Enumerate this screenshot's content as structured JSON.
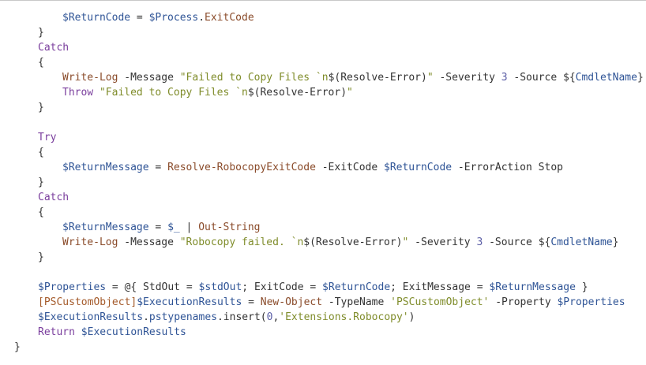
{
  "colors": {
    "background": "#ffffff",
    "default": "#333333",
    "keyword": "#7a3e9d",
    "variable": "#2f5496",
    "command": "#8a4b2a",
    "string": "#7f8c2a",
    "number": "#5b5ea6",
    "type": "#a45a2a"
  },
  "code_lines": [
    {
      "indent": 2,
      "tokens": [
        {
          "t": "variable",
          "v": "$ReturnCode"
        },
        {
          "t": "default",
          "v": " = "
        },
        {
          "t": "variable",
          "v": "$Process"
        },
        {
          "t": "default",
          "v": "."
        },
        {
          "t": "command",
          "v": "ExitCode"
        }
      ]
    },
    {
      "indent": 1,
      "tokens": [
        {
          "t": "default",
          "v": "}"
        }
      ]
    },
    {
      "indent": 1,
      "tokens": [
        {
          "t": "keyword",
          "v": "Catch"
        }
      ]
    },
    {
      "indent": 1,
      "tokens": [
        {
          "t": "default",
          "v": "{"
        }
      ]
    },
    {
      "indent": 2,
      "tokens": [
        {
          "t": "command",
          "v": "Write-Log"
        },
        {
          "t": "default",
          "v": " -Message "
        },
        {
          "t": "string",
          "v": "\"Failed to Copy Files `n"
        },
        {
          "t": "default",
          "v": "$(Resolve-Error)"
        },
        {
          "t": "string",
          "v": "\""
        },
        {
          "t": "default",
          "v": " -Severity "
        },
        {
          "t": "number",
          "v": "3"
        },
        {
          "t": "default",
          "v": " -Source ${"
        },
        {
          "t": "variable",
          "v": "CmdletName"
        },
        {
          "t": "default",
          "v": "}"
        }
      ]
    },
    {
      "indent": 2,
      "tokens": [
        {
          "t": "keyword",
          "v": "Throw"
        },
        {
          "t": "default",
          "v": " "
        },
        {
          "t": "string",
          "v": "\"Failed to Copy Files `n"
        },
        {
          "t": "default",
          "v": "$(Resolve-Error)"
        },
        {
          "t": "string",
          "v": "\""
        }
      ]
    },
    {
      "indent": 1,
      "tokens": [
        {
          "t": "default",
          "v": "}"
        }
      ]
    },
    {
      "indent": 1,
      "tokens": []
    },
    {
      "indent": 1,
      "tokens": [
        {
          "t": "keyword",
          "v": "Try"
        }
      ]
    },
    {
      "indent": 1,
      "tokens": [
        {
          "t": "default",
          "v": "{"
        }
      ]
    },
    {
      "indent": 2,
      "tokens": [
        {
          "t": "variable",
          "v": "$ReturnMessage"
        },
        {
          "t": "default",
          "v": " = "
        },
        {
          "t": "command",
          "v": "Resolve-RobocopyExitCode"
        },
        {
          "t": "default",
          "v": " -ExitCode "
        },
        {
          "t": "variable",
          "v": "$ReturnCode"
        },
        {
          "t": "default",
          "v": " -ErrorAction Stop"
        }
      ]
    },
    {
      "indent": 1,
      "tokens": [
        {
          "t": "default",
          "v": "}"
        }
      ]
    },
    {
      "indent": 1,
      "tokens": [
        {
          "t": "keyword",
          "v": "Catch"
        }
      ]
    },
    {
      "indent": 1,
      "tokens": [
        {
          "t": "default",
          "v": "{"
        }
      ]
    },
    {
      "indent": 2,
      "tokens": [
        {
          "t": "variable",
          "v": "$ReturnMessage"
        },
        {
          "t": "default",
          "v": " = "
        },
        {
          "t": "variable",
          "v": "$_"
        },
        {
          "t": "default",
          "v": " | "
        },
        {
          "t": "command",
          "v": "Out-String"
        }
      ]
    },
    {
      "indent": 2,
      "tokens": [
        {
          "t": "command",
          "v": "Write-Log"
        },
        {
          "t": "default",
          "v": " -Message "
        },
        {
          "t": "string",
          "v": "\"Robocopy failed. `n"
        },
        {
          "t": "default",
          "v": "$(Resolve-Error)"
        },
        {
          "t": "string",
          "v": "\""
        },
        {
          "t": "default",
          "v": " -Severity "
        },
        {
          "t": "number",
          "v": "3"
        },
        {
          "t": "default",
          "v": " -Source ${"
        },
        {
          "t": "variable",
          "v": "CmdletName"
        },
        {
          "t": "default",
          "v": "}"
        }
      ]
    },
    {
      "indent": 1,
      "tokens": [
        {
          "t": "default",
          "v": "}"
        }
      ]
    },
    {
      "indent": 1,
      "tokens": []
    },
    {
      "indent": 1,
      "tokens": [
        {
          "t": "variable",
          "v": "$Properties"
        },
        {
          "t": "default",
          "v": " = @{ StdOut = "
        },
        {
          "t": "variable",
          "v": "$stdOut"
        },
        {
          "t": "default",
          "v": "; ExitCode = "
        },
        {
          "t": "variable",
          "v": "$ReturnCode"
        },
        {
          "t": "default",
          "v": "; ExitMessage = "
        },
        {
          "t": "variable",
          "v": "$ReturnMessage"
        },
        {
          "t": "default",
          "v": " }"
        }
      ]
    },
    {
      "indent": 1,
      "tokens": [
        {
          "t": "type",
          "v": "[PSCustomObject]"
        },
        {
          "t": "variable",
          "v": "$ExecutionResults"
        },
        {
          "t": "default",
          "v": " = "
        },
        {
          "t": "command",
          "v": "New-Object"
        },
        {
          "t": "default",
          "v": " -TypeName "
        },
        {
          "t": "string",
          "v": "'PSCustomObject'"
        },
        {
          "t": "default",
          "v": " -Property "
        },
        {
          "t": "variable",
          "v": "$Properties"
        }
      ]
    },
    {
      "indent": 1,
      "tokens": [
        {
          "t": "variable",
          "v": "$ExecutionResults"
        },
        {
          "t": "default",
          "v": "."
        },
        {
          "t": "variable",
          "v": "pstypenames"
        },
        {
          "t": "default",
          "v": ".insert("
        },
        {
          "t": "number",
          "v": "0"
        },
        {
          "t": "default",
          "v": ","
        },
        {
          "t": "string",
          "v": "'Extensions.Robocopy'"
        },
        {
          "t": "default",
          "v": ")"
        }
      ]
    },
    {
      "indent": 1,
      "tokens": [
        {
          "t": "keyword",
          "v": "Return"
        },
        {
          "t": "default",
          "v": " "
        },
        {
          "t": "variable",
          "v": "$ExecutionResults"
        }
      ]
    },
    {
      "indent": 0,
      "tokens": [
        {
          "t": "default",
          "v": "}"
        }
      ]
    }
  ]
}
